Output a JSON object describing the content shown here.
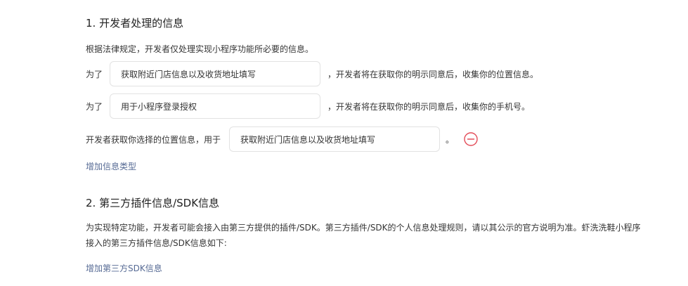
{
  "section1": {
    "title": "1.  开发者处理的信息",
    "intro": "根据法律规定，开发者仅处理实现小程序功能所必要的信息。",
    "rows": [
      {
        "prefix": "为了",
        "value": "获取附近门店信息以及收货地址填写",
        "suffix": "，开发者将在获取你的明示同意后，收集你的位置信息。"
      },
      {
        "prefix": "为了",
        "value": "用于小程序登录授权",
        "suffix": "，开发者将在获取你的明示同意后，收集你的手机号。"
      }
    ],
    "choose_location": {
      "prefix": "开发者获取你选择的位置信息，用于",
      "value": "获取附近门店信息以及收货地址填写",
      "suffix": "。"
    },
    "add_link": "增加信息类型"
  },
  "section2": {
    "title": "2.  第三方插件信息/SDK信息",
    "paragraph": "为实现特定功能，开发者可能会接入由第三方提供的插件/SDK。第三方插件/SDK的个人信息处理规则，请以其公示的官方说明为准。虾洗洗鞋小程序接入的第三方插件信息/SDK信息如下:",
    "add_link": "增加第三方SDK信息"
  },
  "colors": {
    "link": "#576b95",
    "remove_icon": "#e34d59",
    "field_border": "#e2e2e2"
  },
  "icons": {
    "remove": "minus-circle-icon"
  }
}
